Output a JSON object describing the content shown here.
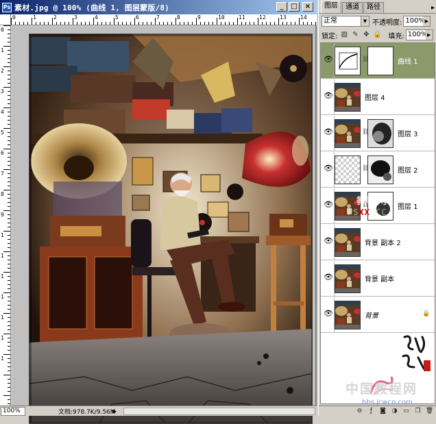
{
  "document": {
    "title": "素材.jpg @ 100% (曲线 1, 图层蒙版/8)",
    "app_icon": "Ps",
    "window_buttons": {
      "minimize": "_",
      "maximize": "□",
      "close": "×"
    },
    "ruler_top_numbers": [
      "0",
      "1",
      "2",
      "3",
      "4",
      "5",
      "6",
      "7",
      "8",
      "9",
      "10",
      "11",
      "12",
      "13",
      "14"
    ],
    "ruler_left_numbers": [
      "0",
      "1",
      "2",
      "3",
      "4",
      "5",
      "6",
      "7",
      "8",
      "9",
      "1",
      "1",
      "1",
      "1",
      "1",
      "1",
      "1"
    ],
    "status": {
      "zoom": "100%",
      "info": "文档:978.7K/9.56M",
      "arrow": "▶"
    },
    "photo_icon": "photo-old-man-gramophones"
  },
  "layers_panel": {
    "tabs": [
      {
        "label": "图层",
        "active": true
      },
      {
        "label": "通道",
        "active": false
      },
      {
        "label": "路径",
        "active": false
      }
    ],
    "menu_glyph": "▸",
    "blend_mode": "正常",
    "opacity_label": "不透明度:",
    "opacity_value": "100%",
    "lock_label": "锁定:",
    "fill_label": "填充:",
    "fill_value": "100%",
    "layers": [
      {
        "name": "曲线 1",
        "selected": true,
        "thumb": "curves-adjustment",
        "mask": "white-mask",
        "locked": false
      },
      {
        "name": "图层 4",
        "selected": false,
        "thumb": "photo",
        "mask": "",
        "locked": false
      },
      {
        "name": "图层 3",
        "selected": false,
        "thumb": "photo",
        "mask": "cloud-mask",
        "locked": false
      },
      {
        "name": "图层 2",
        "selected": false,
        "thumb": "transparent",
        "mask": "dark-cloud-mask",
        "locked": false
      },
      {
        "name": "图层 1",
        "selected": false,
        "thumb": "photo",
        "mask": "light-mask",
        "locked": false
      },
      {
        "name": "背景 副本 2",
        "selected": false,
        "thumb": "photo",
        "mask": "",
        "locked": false
      },
      {
        "name": "背景 副本",
        "selected": false,
        "thumb": "photo",
        "mask": "",
        "locked": false
      },
      {
        "name": "背景",
        "selected": false,
        "thumb": "photo",
        "mask": "",
        "locked": true
      }
    ],
    "bottom_icons": [
      "link-icon",
      "fx-icon",
      "mask-icon",
      "adjustment-icon",
      "folder-icon",
      "new-layer-icon",
      "trash-icon"
    ],
    "bottom_glyphs": [
      "⊖",
      "ƒ",
      "◙",
      "◑",
      "▭",
      "❒",
      "🗑"
    ]
  },
  "watermarks": {
    "jiaocheng": "教程网",
    "url_prefix": "PS",
    "url_xx": "XX",
    "url_suffix": ".CC",
    "site_cn": "中国教程网",
    "site_url": "bbs.jcwcn.com"
  },
  "colors": {
    "titlebar_start": "#0a246a",
    "titlebar_end": "#a6caf0",
    "selected_layer": "#8a9a6a",
    "chrome": "#d4d0c8"
  }
}
